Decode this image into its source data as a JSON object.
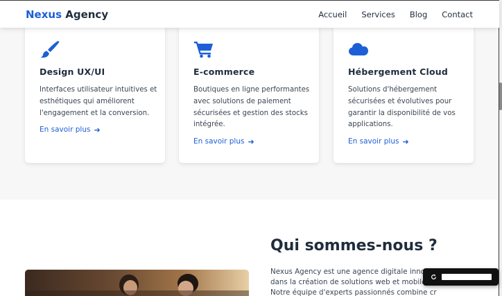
{
  "header": {
    "brand_accent": "Nexus",
    "brand_rest": " Agency",
    "nav": [
      "Accueil",
      "Services",
      "Blog",
      "Contact"
    ]
  },
  "services": {
    "cards": [
      {
        "icon": "paintbrush-icon",
        "title": "Design UX/UI",
        "description": "Interfaces utilisateur intuitives et esthétiques qui améliorent l'engagement et la conversion.",
        "link": "En savoir plus"
      },
      {
        "icon": "shopping-cart-icon",
        "title": "E-commerce",
        "description": "Boutiques en ligne performantes avec solutions de paiement sécurisées et gestion des stocks intégrée.",
        "link": "En savoir plus"
      },
      {
        "icon": "cloud-icon",
        "title": "Hébergement Cloud",
        "description": "Solutions d'hébergement sécurisées et évolutives pour garantir la disponibilité de vos applications.",
        "link": "En savoir plus"
      }
    ]
  },
  "about": {
    "title": "Qui sommes-nous ?",
    "lines": [
      "Nexus Agency est une agence digitale innovan",
      "dans la création de solutions web et mobiles",
      "Notre équipe d'experts passionnés combine créativité et"
    ]
  },
  "colors": {
    "accent": "#1d5fd6",
    "heading": "#1f2d3d",
    "section_bg": "#f7f7f8"
  },
  "toast": {
    "icon": "refresh-icon"
  }
}
